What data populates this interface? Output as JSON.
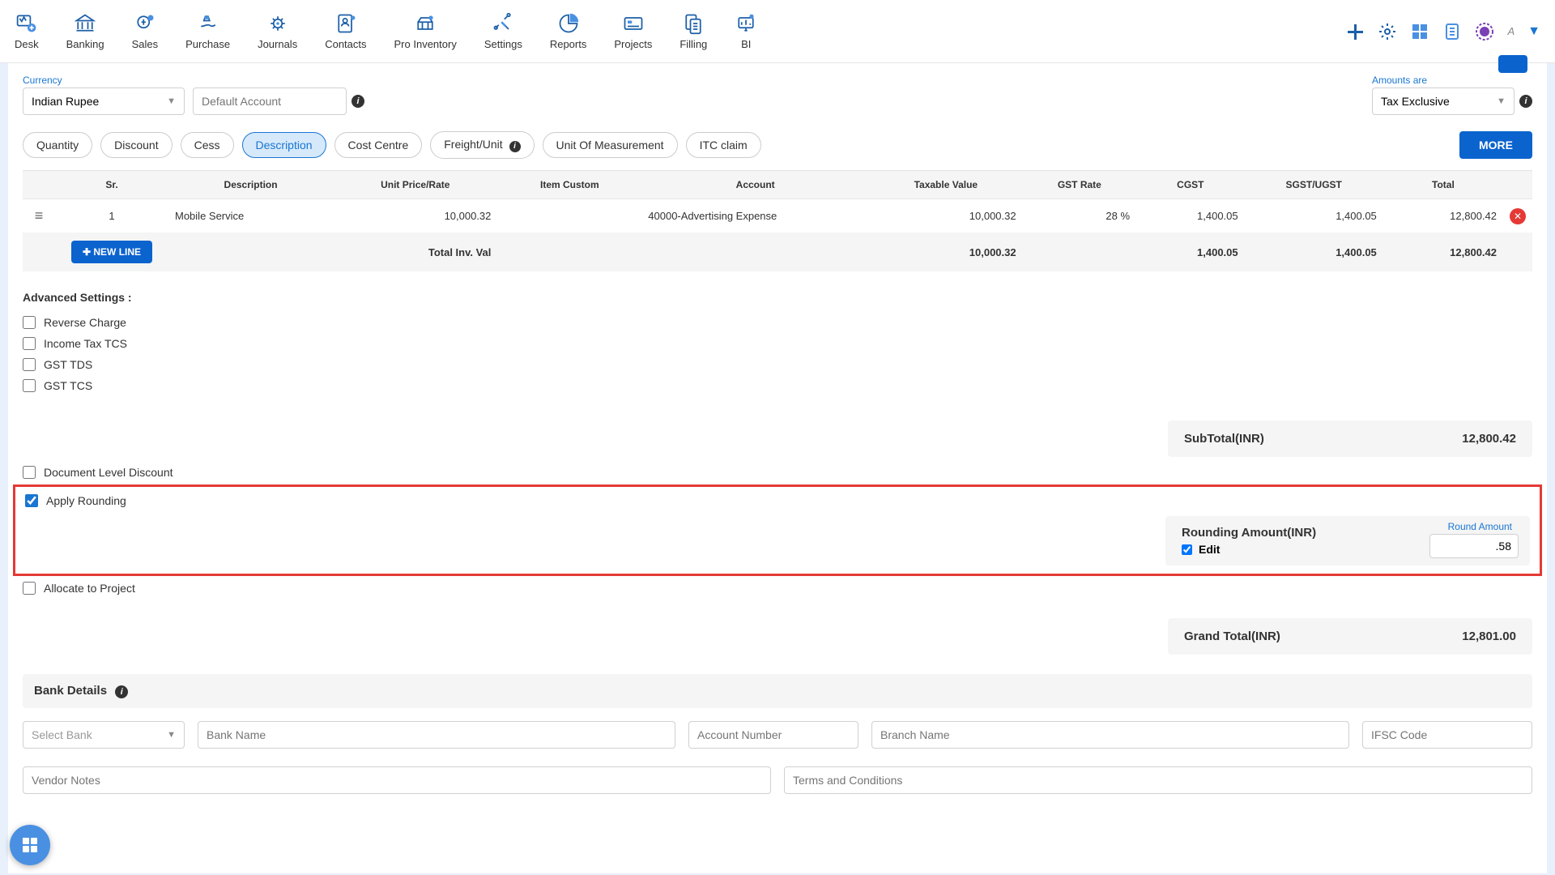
{
  "nav": [
    "Desk",
    "Banking",
    "Sales",
    "Purchase",
    "Journals",
    "Contacts",
    "Pro Inventory",
    "Settings",
    "Reports",
    "Projects",
    "Filling",
    "BI"
  ],
  "currency": {
    "label": "Currency",
    "value": "Indian Rupee"
  },
  "defAccount": {
    "placeholder": "Default Account"
  },
  "amountsAre": {
    "label": "Amounts are",
    "value": "Tax Exclusive"
  },
  "chips": [
    "Quantity",
    "Discount",
    "Cess",
    "Description",
    "Cost Centre",
    "Freight/Unit",
    "Unit Of Measurement",
    "ITC claim"
  ],
  "activeChip": 3,
  "moreBtn": "MORE",
  "headers": [
    "Sr.",
    "Description",
    "Unit Price/Rate",
    "Item Custom",
    "Account",
    "Taxable Value",
    "GST Rate",
    "CGST",
    "SGST/UGST",
    "Total"
  ],
  "row": {
    "sr": "1",
    "desc": "Mobile Service",
    "unit": "10,000.32",
    "custom": "",
    "account": "40000-Advertising Expense",
    "taxable": "10,000.32",
    "gst": "28 %",
    "cgst": "1,400.05",
    "sgst": "1,400.05",
    "total": "12,800.42"
  },
  "totalRow": {
    "label": "Total Inv. Val",
    "taxable": "10,000.32",
    "cgst": "1,400.05",
    "sgst": "1,400.05",
    "total": "12,800.42"
  },
  "newLine": "NEW LINE",
  "advTitle": "Advanced Settings :",
  "adv": [
    {
      "label": "Reverse Charge",
      "checked": false
    },
    {
      "label": "Income Tax TCS",
      "checked": false
    },
    {
      "label": "GST TDS",
      "checked": false
    },
    {
      "label": "GST TCS",
      "checked": false
    }
  ],
  "docDisc": {
    "label": "Document Level Discount",
    "checked": false
  },
  "applyRound": {
    "label": "Apply Rounding",
    "checked": true
  },
  "allocProj": {
    "label": "Allocate to Project",
    "checked": false
  },
  "subTotal": {
    "label": "SubTotal(INR)",
    "value": "12,800.42"
  },
  "rounding": {
    "label": "Rounding Amount(INR)",
    "editLabel": "Edit",
    "roundAmtLabel": "Round Amount",
    "roundAmt": ".58"
  },
  "grandTotal": {
    "label": "Grand Total(INR)",
    "value": "12,801.00"
  },
  "bankDetails": "Bank Details",
  "bank": {
    "select": "Select Bank",
    "name": "Bank Name",
    "acct": "Account Number",
    "branch": "Branch Name",
    "ifsc": "IFSC Code"
  },
  "notes": {
    "vendor": "Vendor Notes",
    "terms": "Terms and Conditions"
  },
  "userInitial": "A"
}
